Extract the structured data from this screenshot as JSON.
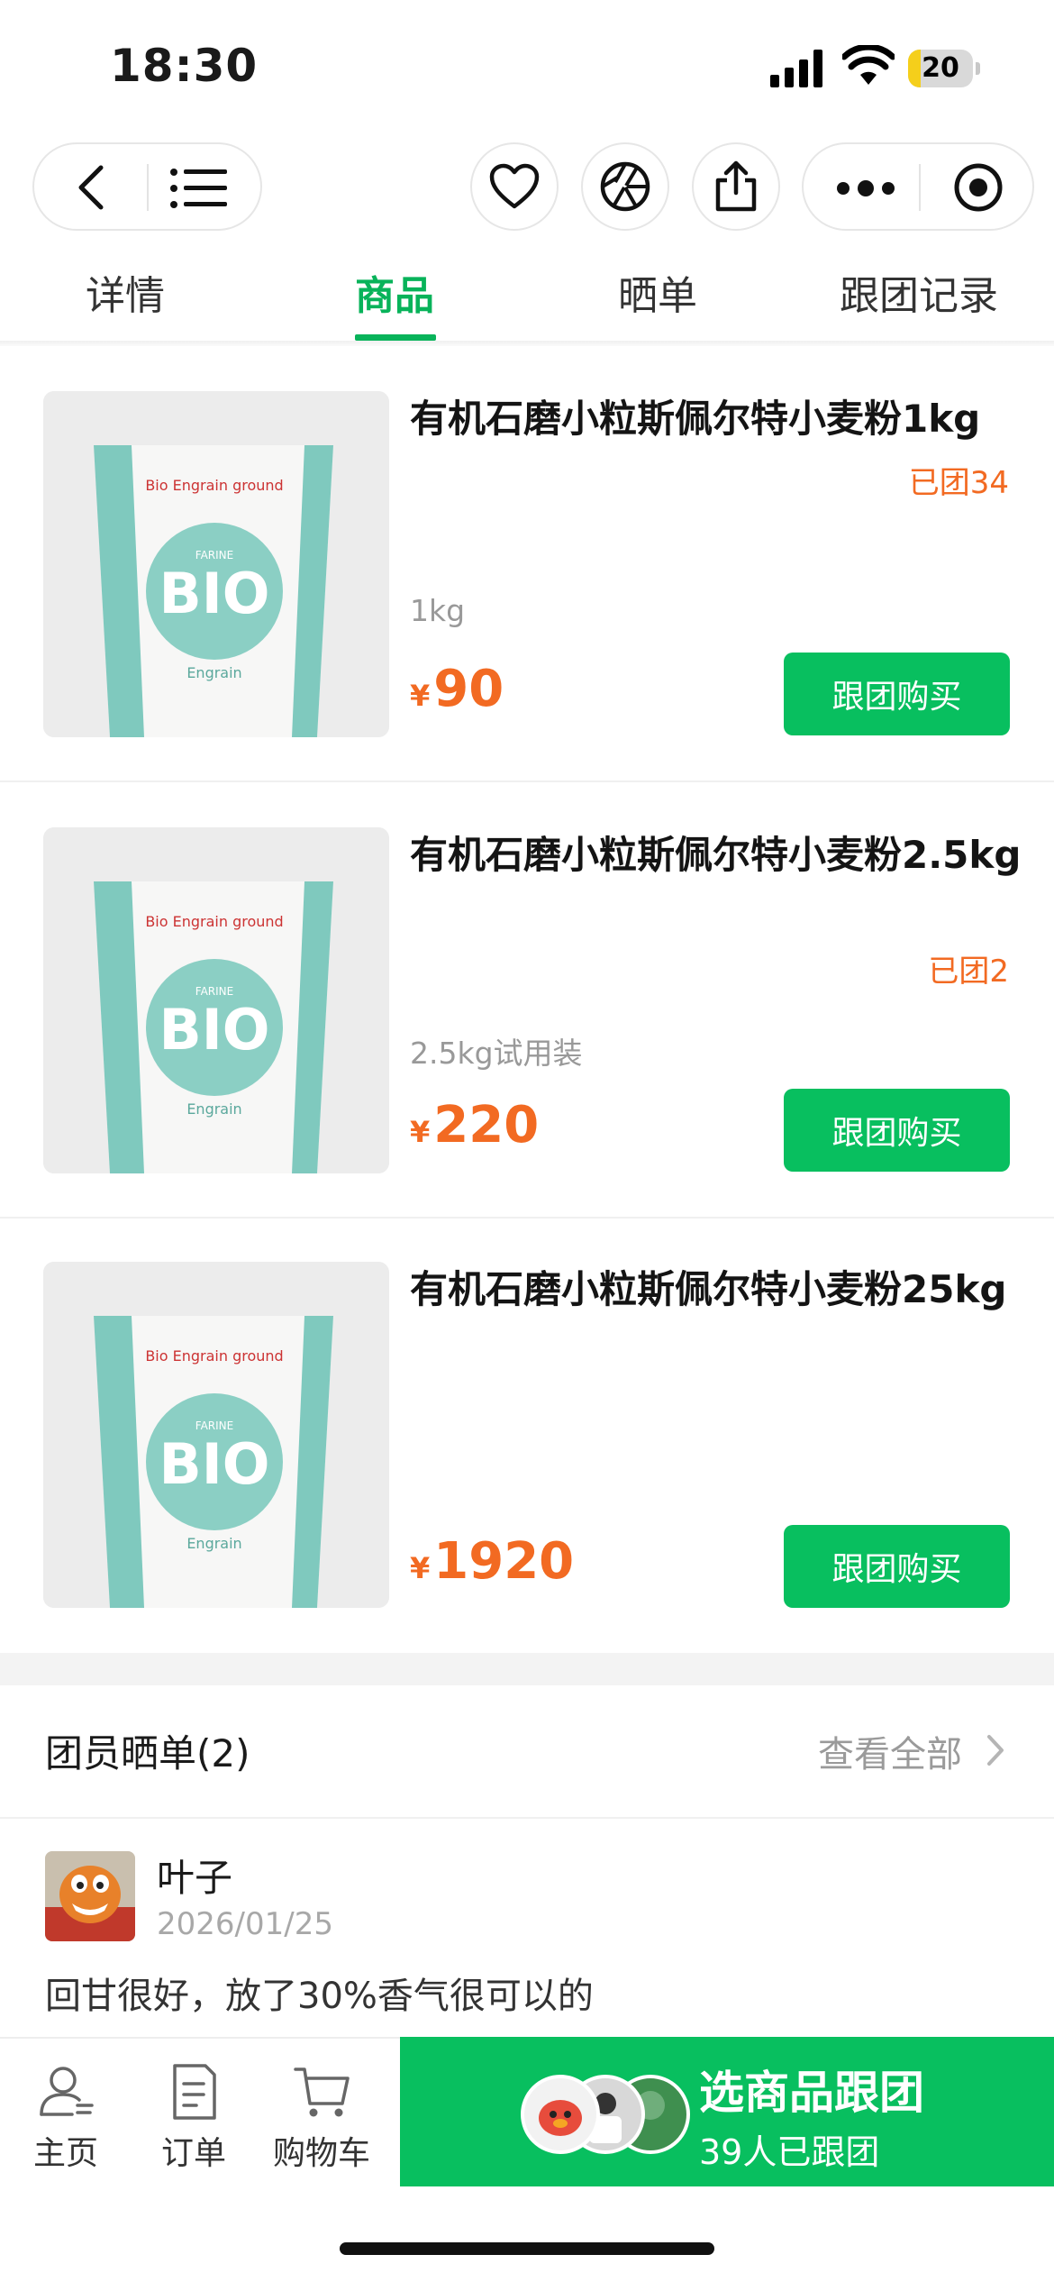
{
  "status_bar": {
    "time": "18:30",
    "battery": "20",
    "battery_level": 0.2
  },
  "nav": {
    "back_icon": "chevron-left-icon",
    "menu_icon": "list-icon",
    "favorite_icon": "heart-icon",
    "camera_icon": "aperture-icon",
    "share_icon": "share-icon",
    "more_icon": "more-dots-icon",
    "close_icon": "target-icon"
  },
  "tabs": [
    {
      "label": "详情",
      "active": false
    },
    {
      "label": "商品",
      "active": true
    },
    {
      "label": "晒单",
      "active": false
    },
    {
      "label": "跟团记录",
      "active": false
    }
  ],
  "products": [
    {
      "title": "有机石磨小粒斯佩尔特小麦粉1kg",
      "sold": "已团34",
      "spec": "1kg",
      "currency": "¥",
      "price": "90",
      "button": "跟团购买",
      "image_text": "Bio Engrain ground",
      "image_brand_small": "FARINE",
      "image_brand": "BIO",
      "image_sub": "Engrain"
    },
    {
      "title": "有机石磨小粒斯佩尔特小麦粉2.5kg",
      "sold": "已团2",
      "spec": "2.5kg试用装",
      "currency": "¥",
      "price": "220",
      "button": "跟团购买",
      "image_text": "Bio Engrain ground",
      "image_brand_small": "FARINE",
      "image_brand": "BIO",
      "image_sub": "Engrain"
    },
    {
      "title": "有机石磨小粒斯佩尔特小麦粉25kg",
      "sold": "",
      "spec": "",
      "currency": "¥",
      "price": "1920",
      "button": "跟团购买",
      "image_text": "Bio Engrain ground",
      "image_brand_small": "FARINE",
      "image_brand": "BIO",
      "image_sub": "Engrain"
    }
  ],
  "reviews": {
    "title": "团员晒单(2)",
    "view_all": "查看全部",
    "items": [
      {
        "name": "叶子",
        "date": "2026/01/25",
        "text": "回甘很好，放了30%香气很可以的"
      }
    ]
  },
  "bottom_nav": [
    {
      "label": "主页",
      "icon": "home-user-icon"
    },
    {
      "label": "订单",
      "icon": "order-doc-icon"
    },
    {
      "label": "购物车",
      "icon": "cart-icon"
    }
  ],
  "cta": {
    "title": "选商品跟团",
    "subtitle": "39人已跟团"
  },
  "colors": {
    "accent_green": "#08bf5f",
    "price_orange": "#f26a22",
    "tab_active": "#08b35a"
  }
}
